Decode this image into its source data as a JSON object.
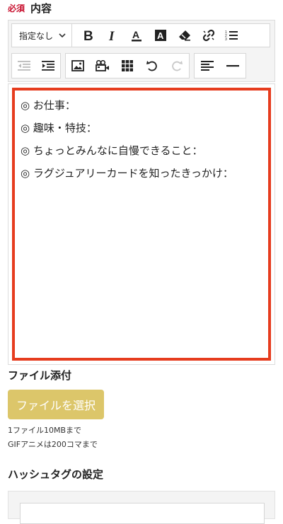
{
  "field": {
    "required_badge": "必須",
    "label": "内容"
  },
  "toolbar": {
    "format_select": {
      "value": "指定なし",
      "icon": "chevron-down-icon"
    },
    "buttons_row1": [
      {
        "name": "bold-button",
        "icon": "bold-icon",
        "enabled": true
      },
      {
        "name": "italic-button",
        "icon": "italic-icon",
        "enabled": true
      },
      {
        "name": "text-color-button",
        "icon": "text-color-icon",
        "enabled": true
      },
      {
        "name": "background-color-button",
        "icon": "background-color-icon",
        "enabled": true
      },
      {
        "name": "clear-format-button",
        "icon": "eraser-icon",
        "enabled": true
      },
      {
        "name": "unlink-button",
        "icon": "unlink-icon",
        "enabled": true
      },
      {
        "name": "ordered-list-button",
        "icon": "ordered-list-icon",
        "enabled": true
      }
    ],
    "buttons_row2": [
      {
        "name": "outdent-button",
        "icon": "outdent-icon",
        "enabled": false
      },
      {
        "name": "indent-button",
        "icon": "indent-icon",
        "enabled": true
      },
      {
        "name": "insert-image-button",
        "icon": "image-icon",
        "enabled": true
      },
      {
        "name": "insert-video-button",
        "icon": "video-icon",
        "enabled": true
      },
      {
        "name": "insert-table-button",
        "icon": "table-grid-icon",
        "enabled": true
      },
      {
        "name": "undo-button",
        "icon": "undo-icon",
        "enabled": true
      },
      {
        "name": "redo-button",
        "icon": "redo-icon",
        "enabled": false
      },
      {
        "name": "align-left-button",
        "icon": "align-left-icon",
        "enabled": true
      },
      {
        "name": "horizontal-rule-button",
        "icon": "horizontal-rule-icon",
        "enabled": true
      }
    ]
  },
  "editor": {
    "lines": [
      "◎ お仕事：",
      "◎ 趣味・特技：",
      "◎ ちょっとみんなに自慢できること：",
      "◎ ラグジュアリーカードを知ったきっかけ："
    ],
    "highlight_color": "#e63c1e"
  },
  "attachment": {
    "title": "ファイル添付",
    "button_label": "ファイルを選択",
    "button_color": "#dcc66a",
    "notes": [
      "1ファイル10MBまで",
      "GIFアニメは200コマまで"
    ]
  },
  "hashtag": {
    "title": "ハッシュタグの設定"
  }
}
